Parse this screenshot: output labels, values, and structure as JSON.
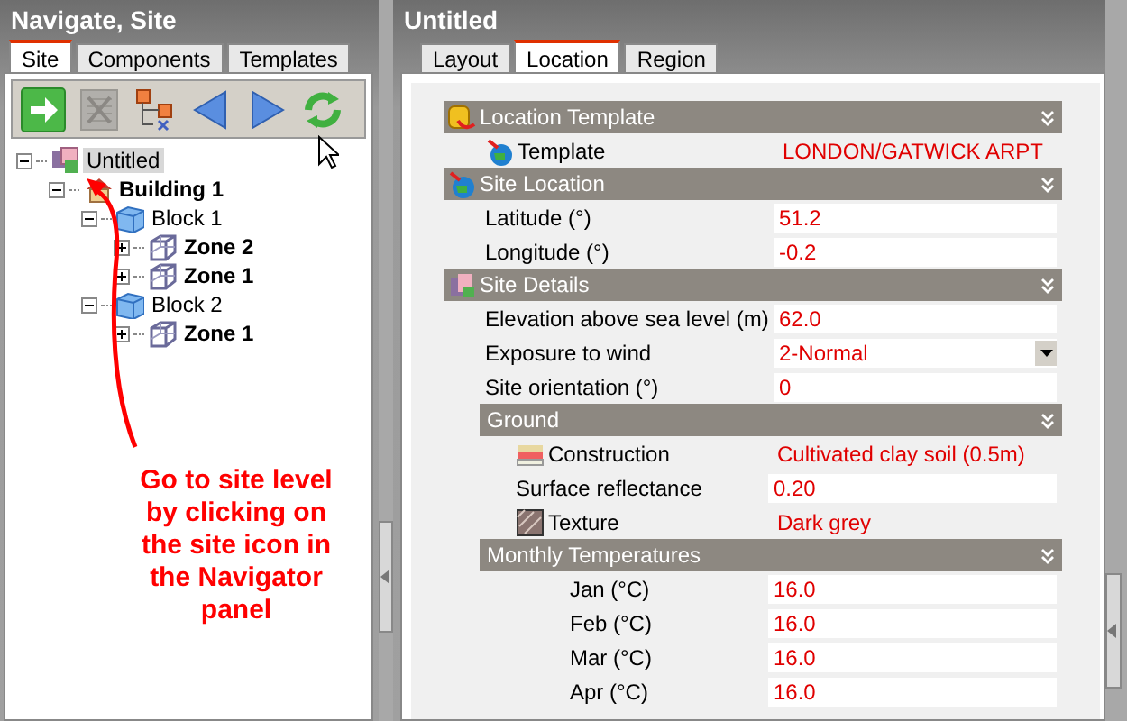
{
  "navigator": {
    "title": "Navigate, Site",
    "tabs": [
      {
        "label": "Site",
        "selected": true
      },
      {
        "label": "Components",
        "selected": false
      },
      {
        "label": "Templates",
        "selected": false
      }
    ],
    "toolbar": [
      {
        "kind": "go",
        "disabled": false
      },
      {
        "kind": "delete",
        "disabled": true
      },
      {
        "kind": "hierarchy",
        "disabled": false
      },
      {
        "kind": "back",
        "disabled": false
      },
      {
        "kind": "forward",
        "disabled": false
      },
      {
        "kind": "refresh",
        "disabled": false
      }
    ],
    "tree": [
      {
        "label": "Untitled",
        "kind": "site",
        "expanded": true,
        "selected": true,
        "children": [
          {
            "label": "Building 1",
            "kind": "building",
            "expanded": true,
            "selected": false,
            "children": [
              {
                "label": "Block 1",
                "kind": "block",
                "expanded": true,
                "selected": false,
                "children": [
                  {
                    "label": "Zone 2",
                    "kind": "zone",
                    "expanded": false,
                    "selected": false
                  },
                  {
                    "label": "Zone 1",
                    "kind": "zone",
                    "expanded": false,
                    "selected": false
                  }
                ]
              },
              {
                "label": "Block 2",
                "kind": "block",
                "expanded": true,
                "selected": false,
                "children": [
                  {
                    "label": "Zone 1",
                    "kind": "zone",
                    "expanded": false,
                    "selected": false
                  }
                ]
              }
            ]
          }
        ]
      }
    ]
  },
  "annotation": {
    "text": "Go to site level by clicking on the site icon in the Navigator panel"
  },
  "editor": {
    "title": "Untitled",
    "tabs": [
      {
        "label": "Layout",
        "selected": false
      },
      {
        "label": "Location",
        "selected": true
      },
      {
        "label": "Region",
        "selected": false
      }
    ],
    "sections": [
      {
        "title": "Location Template",
        "kind": "template",
        "rows": [
          {
            "label": "Template",
            "value": "LONDON/GATWICK ARPT",
            "kind": "globe-link"
          }
        ]
      },
      {
        "title": "Site Location",
        "kind": "location",
        "rows": [
          {
            "label": "Latitude (°)",
            "value": "51.2",
            "kind": "field"
          },
          {
            "label": "Longitude (°)",
            "value": "-0.2",
            "kind": "field"
          }
        ]
      },
      {
        "title": "Site Details",
        "kind": "details",
        "rows": [
          {
            "label": "Elevation above sea level (m)",
            "value": "62.0",
            "kind": "field"
          },
          {
            "label": "Exposure to wind",
            "value": "2-Normal",
            "kind": "dropdown"
          },
          {
            "label": "Site orientation (°)",
            "value": "0",
            "kind": "field"
          }
        ]
      },
      {
        "title": "Ground",
        "kind": "ground",
        "rows": [
          {
            "label": "Construction",
            "value": "Cultivated clay soil (0.5m)",
            "kind": "layers-link"
          },
          {
            "label": "Surface reflectance",
            "value": "0.20",
            "kind": "field"
          },
          {
            "label": "Texture",
            "value": "Dark grey",
            "kind": "texture-link"
          }
        ]
      },
      {
        "title": "Monthly Temperatures",
        "kind": "monthly",
        "rows": [
          {
            "label": "Jan (°C)",
            "value": "16.0",
            "kind": "field"
          },
          {
            "label": "Feb (°C)",
            "value": "16.0",
            "kind": "field"
          },
          {
            "label": "Mar (°C)",
            "value": "16.0",
            "kind": "field"
          },
          {
            "label": "Apr (°C)",
            "value": "16.0",
            "kind": "field"
          }
        ]
      }
    ]
  }
}
